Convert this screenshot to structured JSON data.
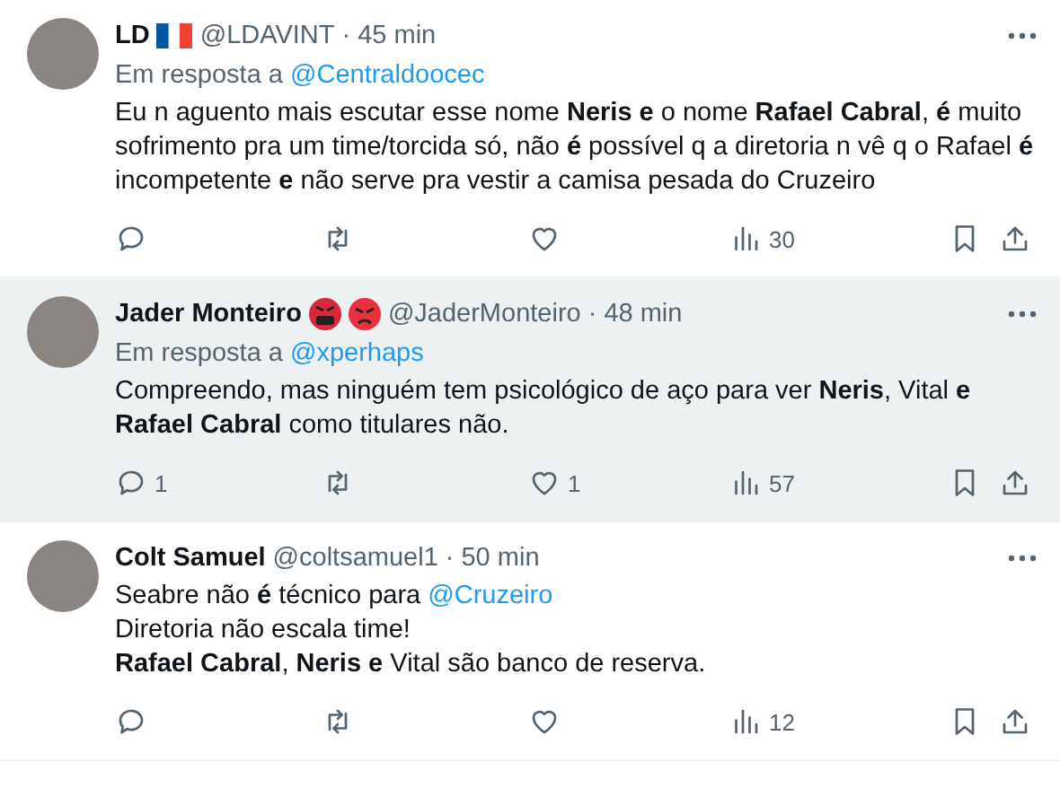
{
  "tweets": [
    {
      "name": "LD",
      "badges": [
        {
          "kind": "flag"
        }
      ],
      "handle": "@LDAVINT",
      "time": "· 45 min",
      "highlighted": false,
      "reply_prefix": "Em resposta a",
      "reply_to": "@Centraldoocec",
      "lines": [
        {
          "text": "Eu n aguento mais escutar esse nome **Neris e** o nome **Rafael Cabral**, **é** muito sofrimento pra um time/torcida só, não **é** possível q a diretoria n vê q o Rafael **é** incompetente **e** não serve pra vestir a camisa pesada do Cruzeiro"
        }
      ],
      "actions": [
        {
          "kind": "reply"
        },
        {
          "kind": "repost"
        },
        {
          "kind": "like"
        },
        {
          "kind": "views",
          "count": "30"
        }
      ]
    },
    {
      "name": "Jader Monteiro",
      "badges": [
        {
          "kind": "cursing-face"
        },
        {
          "kind": "angry-face"
        }
      ],
      "handle": "@JaderMonteiro",
      "time": "· 48 min",
      "highlighted": true,
      "reply_prefix": "Em resposta a",
      "reply_to": "@xperhaps",
      "lines": [
        {
          "text": "Compreendo, mas ninguém tem psicológico de aço para ver **Neris**, Vital **e** **Rafael Cabral** como titulares não."
        }
      ],
      "actions": [
        {
          "kind": "reply",
          "count": "1"
        },
        {
          "kind": "repost"
        },
        {
          "kind": "like",
          "count": "1"
        },
        {
          "kind": "views",
          "count": "57"
        }
      ]
    },
    {
      "name": "Colt Samuel",
      "handle": "@coltsamuel1",
      "time": "· 50 min",
      "highlighted": false,
      "lines": [
        {
          "text": "Seabre não **é** técnico para",
          "mention": "@Cruzeiro"
        },
        {
          "text": "Diretoria não escala time!"
        },
        {
          "text": "**Rafael Cabral**, **Neris e** Vital são banco de reserva."
        }
      ],
      "actions": [
        {
          "kind": "reply"
        },
        {
          "kind": "repost"
        },
        {
          "kind": "like"
        },
        {
          "kind": "views",
          "count": "12"
        }
      ]
    }
  ]
}
